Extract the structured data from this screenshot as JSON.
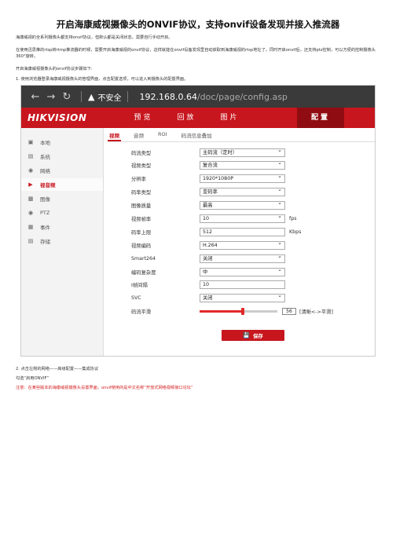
{
  "doc": {
    "title": "开启海康威视摄像头的ONVIF协议，支持onvif设备发现并接入推流器",
    "para1": "海康威视的全系列摄像头都支持onvif协议，但默认都是关闭状态，需要自行手动开启。",
    "para2": "在使用迅思推的rtsp转rtmp推流器的时候，需要开启海康威视的onvif协议，这样就能在onvif设备发现里自动获取到海康威视的rtsp地址了，同时开启onvif后，还支持ptz控制，可以方便的控制摄像头360°旋转。",
    "para3": "开启海康威视摄像头的onvif协议步骤如下:",
    "para4": "1. 使用浏览器登录海康威视摄像头的管理界面，点击配置选项，可以进入到摄像头的配置界面。",
    "para5": "2. 点击左侧的网络——高级配置——集成协议",
    "para6": "勾选“启用ONVIF”",
    "para7": "注意：在某些版本的海康威视摄像头设置界面，onvif使用的是中文名称“开放式网络视频接口论坛”"
  },
  "browser": {
    "back_icon": "arrow-left",
    "forward_icon": "arrow-right",
    "reload_icon": "reload",
    "warning_icon": "warning-triangle",
    "insecure": "不安全",
    "host": "192.168.0.64",
    "path": "/doc/page/config.asp"
  },
  "hik": {
    "logo": "HIKVISION",
    "nav": [
      "预览",
      "回放",
      "图片",
      "配置"
    ],
    "sidebar": [
      {
        "label": "本地",
        "icon": "monitor-icon"
      },
      {
        "label": "系统",
        "icon": "system-icon"
      },
      {
        "label": "网络",
        "icon": "globe-icon"
      },
      {
        "label": "视音频",
        "icon": "video-icon"
      },
      {
        "label": "图像",
        "icon": "image-icon"
      },
      {
        "label": "PTZ",
        "icon": "ptz-icon"
      },
      {
        "label": "事件",
        "icon": "event-icon"
      },
      {
        "label": "存储",
        "icon": "storage-icon"
      }
    ],
    "tabs": [
      "视频",
      "音频",
      "ROI",
      "码流信息叠加"
    ],
    "fields": [
      {
        "label": "码流类型",
        "value": "主码流（定时）",
        "dropdown": true,
        "unit": ""
      },
      {
        "label": "视频类型",
        "value": "复合流",
        "dropdown": true,
        "unit": ""
      },
      {
        "label": "分辨率",
        "value": "1920*1080P",
        "dropdown": true,
        "unit": ""
      },
      {
        "label": "码率类型",
        "value": "变码率",
        "dropdown": true,
        "unit": ""
      },
      {
        "label": "图像质量",
        "value": "最高",
        "dropdown": true,
        "unit": ""
      },
      {
        "label": "视频帧率",
        "value": "10",
        "dropdown": true,
        "unit": "fps"
      },
      {
        "label": "码率上限",
        "value": "512",
        "dropdown": false,
        "unit": "Kbps"
      },
      {
        "label": "视频编码",
        "value": "H.264",
        "dropdown": true,
        "unit": ""
      },
      {
        "label": "Smart264",
        "value": "关闭",
        "dropdown": true,
        "unit": ""
      },
      {
        "label": "编码复杂度",
        "value": "中",
        "dropdown": true,
        "unit": ""
      },
      {
        "label": "I帧间隔",
        "value": "10",
        "dropdown": false,
        "unit": ""
      },
      {
        "label": "SVC",
        "value": "关闭",
        "dropdown": true,
        "unit": ""
      }
    ],
    "smoothing": {
      "label": "码流平滑",
      "value": "56",
      "level": 0.56,
      "hint": "[清晰<->平滑]"
    },
    "save": "保存",
    "accent": "#c7161e"
  }
}
